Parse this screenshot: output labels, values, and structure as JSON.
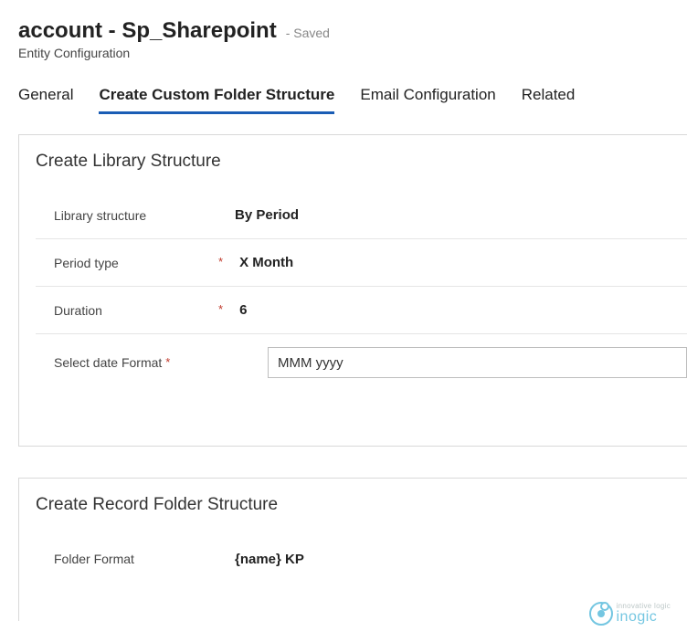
{
  "header": {
    "title": "account - Sp_Sharepoint",
    "status": "- Saved",
    "subtitle": "Entity Configuration"
  },
  "tabs": {
    "general": "General",
    "custom": "Create Custom Folder Structure",
    "email": "Email Configuration",
    "related": "Related"
  },
  "library": {
    "heading": "Create Library Structure",
    "structure_label": "Library structure",
    "structure_value": "By Period",
    "period_label": "Period type",
    "period_value": "X Month",
    "duration_label": "Duration",
    "duration_value": "6",
    "dateformat_label": "Select date Format",
    "dateformat_value": "MMM yyyy"
  },
  "record": {
    "heading": "Create Record Folder Structure",
    "format_label": "Folder Format",
    "format_value": "{name} KP"
  },
  "logo": {
    "tagline": "innovative logic",
    "brand": "inogic"
  }
}
